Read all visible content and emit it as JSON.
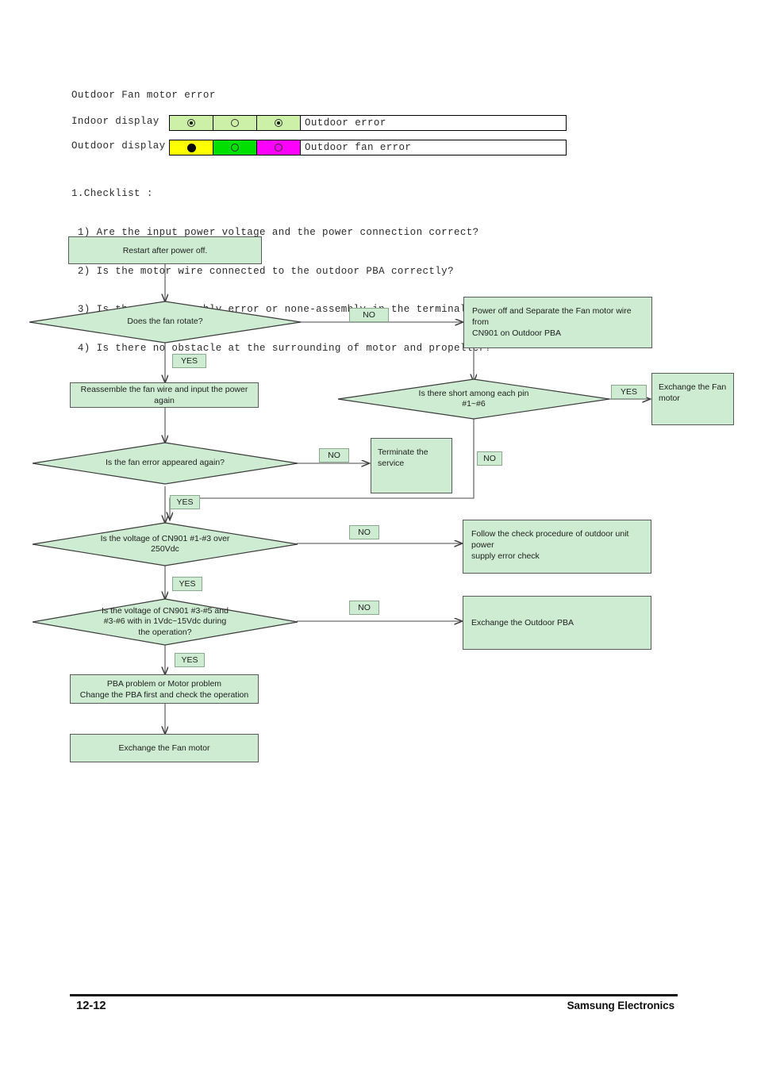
{
  "header": {
    "title": "Outdoor Fan motor error",
    "indoor": {
      "label": "Indoor display",
      "lamps": [
        {
          "icon": "ring-dot-icon",
          "bg": "#cdf0a8"
        },
        {
          "icon": "ring-icon",
          "bg": "#cdf0a8"
        },
        {
          "icon": "ring-dot-icon",
          "bg": "#cdf0a8"
        }
      ],
      "message": "Outdoor error"
    },
    "outdoor": {
      "label": "Outdoor display",
      "lamps": [
        {
          "icon": "filled-disc-icon",
          "bg": "#ffff00"
        },
        {
          "icon": "ring-icon",
          "bg": "#00e000"
        },
        {
          "icon": "ring-icon",
          "bg": "#ff00ff"
        }
      ],
      "message": "Outdoor fan error"
    }
  },
  "checklist": {
    "heading": "1.Checklist :",
    "items": [
      " 1) Are the input power voltage and the power connection correct?",
      " 2) Is the motor wire connected to the outdoor PBA correctly?",
      " 3) Is there no assembly error or none-assembly in the terminal of motor wire connector?",
      " 4) Is there no obstacle at the surrounding of motor and propeller?"
    ]
  },
  "flowchart": {
    "type": "flowchart",
    "fill": "#cdecd1",
    "stroke": "#5a5a5a",
    "nodes": {
      "restart": "Restart after power off.",
      "fan_rotate": "Does the fan rotate?",
      "reassemble": "Reassemble the fan wire and input the power again",
      "power_off_separate": "Power off and Separate the Fan motor wire from CN901 on Outdoor PBA",
      "short_pins": "Is there short among each pin #1~#6",
      "exchange_fan_motor_right": "Exchange the Fan motor",
      "fan_error_again": "Is the fan error appeared again?",
      "terminate": "Terminate the service",
      "voltage_1_3": "Is the voltage of CN901 #1-#3 over 250Vdc",
      "follow_power_check": "Follow the check procedure of outdoor unit power supply error check",
      "voltage_3_5": "Is the voltage of CN901 #3-#5 and #3-#6 with in 1Vdc~15Vdc during the operation?",
      "exchange_outdoor_pba": "Exchange the Outdoor PBA",
      "pba_or_motor": "PBA problem or Motor problem Change the PBA first and check the operation",
      "exchange_fan_motor_bottom": "Exchange the Fan motor"
    },
    "node_lines": {
      "power_off_separate": [
        "Power off and Separate the Fan motor wire from",
        "CN901 on Outdoor PBA"
      ],
      "short_pins": [
        "Is there short among each pin",
        "#1~#6"
      ],
      "exchange_fan_motor_right": [
        "Exchange the Fan",
        "motor"
      ],
      "terminate": [
        "Terminate the",
        "service"
      ],
      "voltage_1_3": [
        "Is the voltage of CN901 #1-#3 over",
        "250Vdc"
      ],
      "follow_power_check": [
        "Follow the check procedure of outdoor unit power",
        "supply error check"
      ],
      "voltage_3_5": [
        "Is the voltage of CN901 #3-#5 and",
        "#3-#6 with in 1Vdc~15Vdc during",
        "the operation?"
      ],
      "pba_or_motor": [
        "PBA problem or Motor problem",
        "Change the PBA first and check the operation"
      ]
    },
    "edge_labels": {
      "rotate_no": "NO",
      "rotate_yes": "YES",
      "short_yes": "YES",
      "short_no": "NO",
      "error_again_no": "NO",
      "error_again_yes": "YES",
      "v13_no": "NO",
      "v13_yes": "YES",
      "v35_no": "NO",
      "v35_yes": "YES"
    }
  },
  "footer": {
    "page": "12-12",
    "brand": "Samsung Electronics"
  }
}
